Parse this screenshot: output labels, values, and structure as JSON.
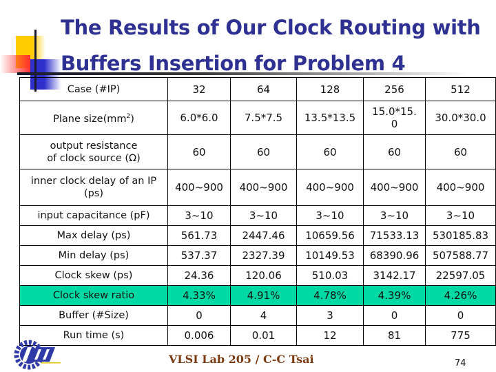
{
  "slide": {
    "title_line1": "The Results of Our Clock Routing with",
    "title_line2": "Buffers Insertion for Problem 4",
    "footer": "VLSI Lab 205 / C-C Tsai",
    "page_number": "74",
    "logo_text": "NTUT"
  },
  "colors": {
    "title": "#2e3191",
    "highlight_row": "#00d9a3",
    "footer": "#7b3a10"
  },
  "table": {
    "header": {
      "label": "Case (#IP)",
      "values": [
        "32",
        "64",
        "128",
        "256",
        "512"
      ]
    },
    "rows": [
      {
        "label": "Plane size(mm",
        "label_sup": "2",
        "label_end": ")",
        "values": [
          "6.0*6.0",
          "7.5*7.5",
          "13.5*13.5",
          "15.0*15.\n0",
          "30.0*30.0"
        ]
      },
      {
        "label": "output resistance\nof clock source (Ω)",
        "values": [
          "60",
          "60",
          "60",
          "60",
          "60"
        ]
      },
      {
        "label": "inner clock delay of an IP\n(ps)",
        "values": [
          "400~900",
          "400~900",
          "400~900",
          "400~900",
          "400~900"
        ]
      },
      {
        "label": "input capacitance (pF)",
        "values": [
          "3~10",
          "3~10",
          "3~10",
          "3~10",
          "3~10"
        ]
      },
      {
        "label": "Max delay (ps)",
        "values": [
          "561.73",
          "2447.46",
          "10659.56",
          "71533.13",
          "530185.83"
        ]
      },
      {
        "label": "Min delay (ps)",
        "values": [
          "537.37",
          "2327.39",
          "10149.53",
          "68390.96",
          "507588.77"
        ]
      },
      {
        "label": "Clock skew (ps)",
        "values": [
          "24.36",
          "120.06",
          "510.03",
          "3142.17",
          "22597.05"
        ]
      },
      {
        "label": "Clock skew ratio",
        "values": [
          "4.33%",
          "4.91%",
          "4.78%",
          "4.39%",
          "4.26%"
        ],
        "highlight": true
      },
      {
        "label": "Buffer (#Size)",
        "values": [
          "0",
          "4",
          "3",
          "0",
          "0"
        ]
      },
      {
        "label": "Run time (s)",
        "values": [
          "0.006",
          "0.01",
          "12",
          "81",
          "775"
        ]
      }
    ]
  }
}
